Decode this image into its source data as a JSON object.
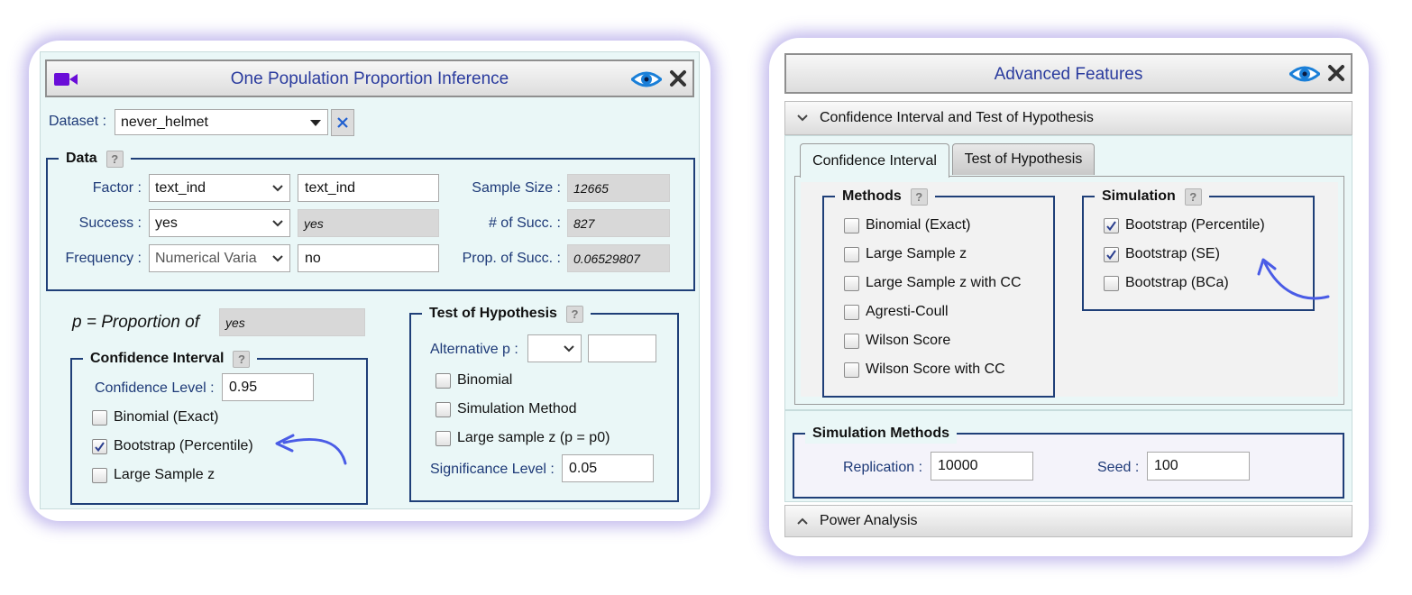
{
  "colors": {
    "title": "#2a3b9e",
    "label": "#1e3a78",
    "panel_bg": "#eaf7f7",
    "fieldset_border": "#1f3f78",
    "glow": "#7c64d7",
    "arrow": "#4a5ce6",
    "video_icon": "#6a0dd8",
    "eye_icon": "#1a7fd8"
  },
  "left": {
    "title": "One Population Proportion Inference",
    "icons": {
      "video": "video-camera-icon",
      "view": "eye-icon",
      "close": "close-icon"
    },
    "dataset": {
      "label": "Dataset :",
      "value": "never_helmet"
    },
    "data": {
      "legend": "Data",
      "help": "?",
      "factor": {
        "label": "Factor :",
        "select": "text_ind",
        "input": "text_ind"
      },
      "success": {
        "label": "Success :",
        "select": "yes",
        "value": "yes"
      },
      "frequency": {
        "label": "Frequency :",
        "select": "Numerical Varia",
        "input": "no"
      },
      "sample_size": {
        "label": "Sample Size :",
        "value": "12665"
      },
      "num_succ": {
        "label": "# of Succ. :",
        "value": "827"
      },
      "prop_succ": {
        "label": "Prop. of Succ. :",
        "value": "0.06529807"
      }
    },
    "proportion": {
      "prefix": "p",
      "text": " = Proportion of",
      "value": "yes"
    },
    "ci": {
      "legend": "Confidence Interval",
      "help": "?",
      "level_label": "Confidence Level :",
      "level_value": "0.95",
      "options": [
        {
          "label": "Binomial (Exact)",
          "checked": false
        },
        {
          "label": "Bootstrap (Percentile)",
          "checked": true
        },
        {
          "label": "Large Sample z",
          "checked": false
        }
      ]
    },
    "test": {
      "legend": "Test of Hypothesis",
      "help": "?",
      "alt_label": "Alternative p :",
      "alt_select": "",
      "alt_value": "",
      "options": [
        {
          "label": "Binomial",
          "checked": false
        },
        {
          "label": "Simulation Method",
          "checked": false
        },
        {
          "label": "Large sample z (p = p0)",
          "checked": false
        }
      ],
      "sig_label": "Significance Level :",
      "sig_value": "0.05"
    }
  },
  "right": {
    "title": "Advanced Features",
    "icons": {
      "view": "eye-icon",
      "close": "close-icon"
    },
    "section1": "Confidence Interval and Test of Hypothesis",
    "tabs": [
      "Confidence Interval",
      "Test of Hypothesis"
    ],
    "active_tab": "Confidence Interval",
    "methods": {
      "legend": "Methods",
      "help": "?",
      "options": [
        {
          "label": "Binomial (Exact)",
          "checked": false
        },
        {
          "label": "Large Sample z",
          "checked": false
        },
        {
          "label": "Large Sample z with CC",
          "checked": false
        },
        {
          "label": "Agresti-Coull",
          "checked": false
        },
        {
          "label": "Wilson Score",
          "checked": false
        },
        {
          "label": "Wilson Score with CC",
          "checked": false
        }
      ]
    },
    "simulation": {
      "legend": "Simulation",
      "help": "?",
      "options": [
        {
          "label": "Bootstrap (Percentile)",
          "checked": true
        },
        {
          "label": "Bootstrap (SE)",
          "checked": true
        },
        {
          "label": "Bootstrap (BCa)",
          "checked": false
        }
      ]
    },
    "sim_methods": {
      "legend": "Simulation Methods",
      "replication_label": "Replication :",
      "replication_value": "10000",
      "seed_label": "Seed :",
      "seed_value": "100"
    },
    "section2": "Power Analysis"
  }
}
